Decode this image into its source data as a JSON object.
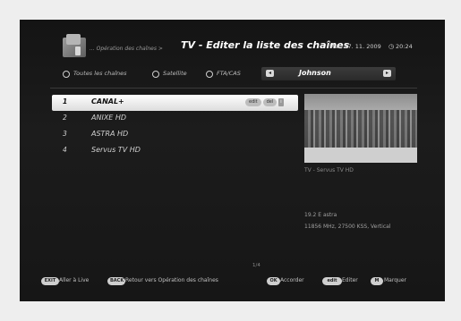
{
  "header": {
    "breadcrumb": "... Opération des chaînes >",
    "title": "TV - Editer la liste des chaînes",
    "date": "Mar, 17. 11. 2009",
    "time": "20:24"
  },
  "filters": {
    "options": [
      "Toutes les chaînes",
      "Satellite",
      "FTA/CAS"
    ],
    "group": {
      "left_arrow": "◂",
      "name": "Johnson",
      "right_arrow": "▸"
    }
  },
  "channels": [
    {
      "number": "1",
      "name": "CANAL+",
      "badges": [
        "edit",
        "del",
        "i"
      ],
      "selected": true
    },
    {
      "number": "2",
      "name": "ANIXE HD"
    },
    {
      "number": "3",
      "name": "ASTRA HD"
    },
    {
      "number": "4",
      "name": "Servus TV HD"
    }
  ],
  "preview": {
    "caption": "TV - Servus TV HD",
    "satellite": "19.2 E astra",
    "transponder": "11856 MHz, 27500 KSS, Vertical"
  },
  "page_indicator": "1/4",
  "footer": [
    {
      "key": "EXIT",
      "label": "Aller à Live"
    },
    {
      "key": "BACK",
      "label": "Retour vers Opération des chaînes"
    },
    {
      "key": "OK",
      "label": "Accorder"
    },
    {
      "key": "edit",
      "label": "Editer"
    },
    {
      "key": "M",
      "label": "Marquer"
    }
  ]
}
